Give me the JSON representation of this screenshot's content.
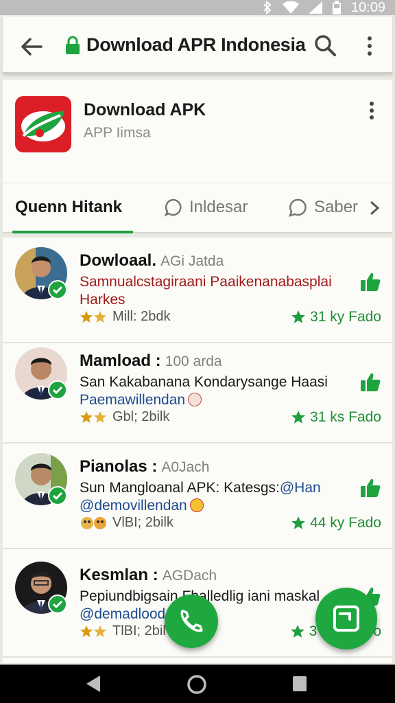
{
  "status_bar": {
    "time": "10:09"
  },
  "app_bar": {
    "title": "Download APR Indonesia"
  },
  "app_card": {
    "name": "Download APK",
    "subtitle": "APP Iimsa"
  },
  "tabs": [
    {
      "label": "Quenn Hitank",
      "active": true
    },
    {
      "label": "Inldesar",
      "active": false
    },
    {
      "label": "Saber",
      "active": false
    }
  ],
  "posts": [
    {
      "author": "Dowloaal.",
      "time": "AGi Jatda",
      "text": "Samnualcstagiraani Paaikenanabasplai Harkes",
      "text_tag": "",
      "text_color": "red",
      "meta": "Mill: 2bdk",
      "stat": "31 ky Fado"
    },
    {
      "author": "Mamload :",
      "time": "100 arda",
      "text": "San Kakabanana Kondarysange Haasi",
      "text_tag": "Paemawillendan",
      "text_color": "normal",
      "meta": "Gbl; 2bilk",
      "stat": "31 ks Fado"
    },
    {
      "author": "Pianolas :",
      "time": "A0Jach",
      "text": "Sun Mangloanal APK: Katesgs:",
      "text_tag": "@demovillendan",
      "text_tag_inline": "@Han",
      "text_color": "normal",
      "meta": "VlBI; 2bilk",
      "stat": "44 ky Fado"
    },
    {
      "author": "Kesmlan :",
      "time": "AGDach",
      "text": "Pepiundbigsain Fhalledlig iani maskal",
      "text_tag": "@demadlooda",
      "text_color": "normal",
      "meta": "TlBI; 2bil",
      "stat": "3",
      "stat_tail": "o"
    }
  ],
  "colors": {
    "accent": "#1fa83f",
    "brand_red": "#dc1f26",
    "link": "#1f4b91"
  }
}
